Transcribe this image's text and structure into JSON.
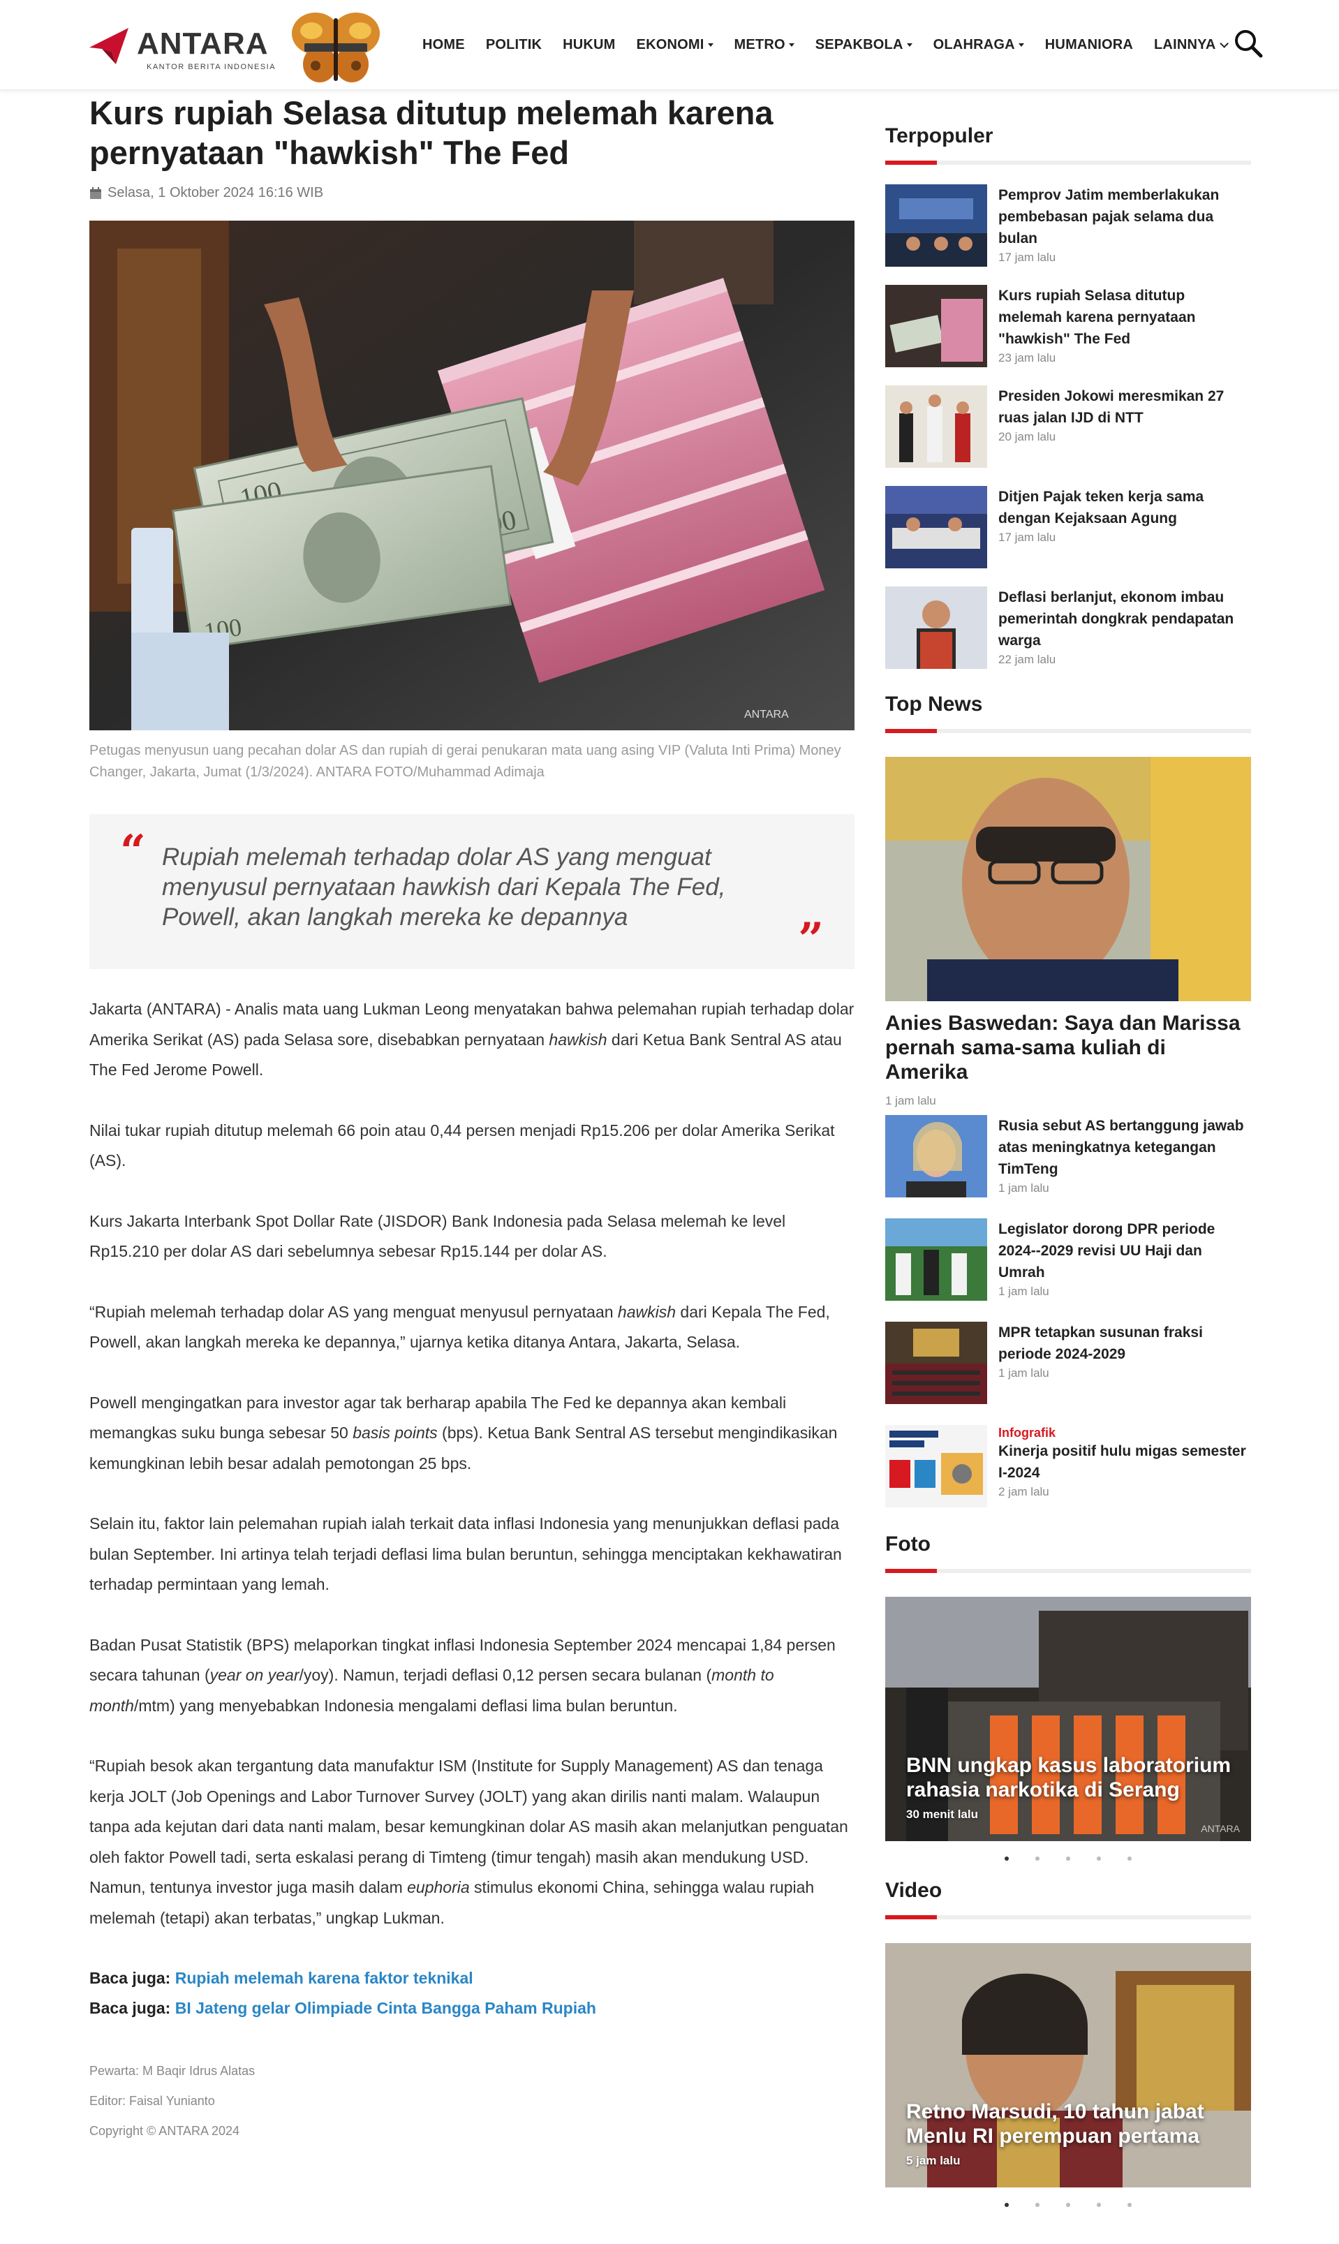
{
  "colors": {
    "accent": "#d71920",
    "link": "#2a86c5",
    "muted": "#888888"
  },
  "header": {
    "logo_text": "ANTARA",
    "logo_sub": "KANTOR BERITA INDONESIA",
    "nav": [
      {
        "label": "HOME",
        "dropdown": false
      },
      {
        "label": "POLITIK",
        "dropdown": false
      },
      {
        "label": "HUKUM",
        "dropdown": false
      },
      {
        "label": "EKONOMI",
        "dropdown": true
      },
      {
        "label": "METRO",
        "dropdown": true
      },
      {
        "label": "SEPAKBOLA",
        "dropdown": true
      },
      {
        "label": "OLAHRAGA",
        "dropdown": true
      },
      {
        "label": "HUMANIORA",
        "dropdown": false
      },
      {
        "label": "LAINNYA",
        "dropdown": true
      }
    ],
    "search_icon": "search-icon"
  },
  "article": {
    "title": "Kurs rupiah Selasa ditutup melemah karena pernyataan \"hawkish\" The Fed",
    "date": "Selasa, 1 Oktober 2024 16:16 WIB",
    "image_watermark": "ANTARA",
    "caption": "Petugas menyusun uang pecahan dolar AS dan rupiah di gerai penukaran mata uang asing VIP (Valuta Inti Prima) Money Changer, Jakarta, Jumat (1/3/2024). ANTARA FOTO/Muhammad Adimaja",
    "quote": "Rupiah melemah terhadap dolar AS yang menguat menyusul pernyataan hawkish dari Kepala The Fed, Powell, akan langkah mereka ke depannya",
    "paragraphs": [
      "Jakarta (ANTARA) - Analis mata uang Lukman Leong menyatakan bahwa pelemahan rupiah terhadap dolar Amerika Serikat (AS) pada Selasa sore, disebabkan pernyataan <em>hawkish</em> dari Ketua Bank Sentral AS atau The Fed Jerome Powell.",
      "Nilai tukar rupiah ditutup melemah 66 poin atau 0,44 persen menjadi Rp15.206 per dolar Amerika Serikat (AS).",
      "Kurs Jakarta Interbank Spot Dollar Rate (JISDOR) Bank Indonesia pada Selasa melemah ke level Rp15.210 per dolar AS dari sebelumnya sebesar Rp15.144 per dolar AS.",
      "“Rupiah melemah terhadap dolar AS yang menguat menyusul pernyataan <em>hawkish</em> dari Kepala The Fed, Powell, akan langkah mereka ke depannya,” ujarnya ketika ditanya Antara, Jakarta, Selasa.",
      "Powell mengingatkan para investor agar tak berharap apabila The Fed ke depannya akan kembali memangkas suku bunga sebesar 50 <em>basis points</em> (bps). Ketua Bank Sentral AS tersebut mengindikasikan kemungkinan lebih besar adalah pemotongan 25 bps.",
      "Selain itu, faktor lain pelemahan rupiah ialah terkait data inflasi Indonesia yang menunjukkan deflasi pada bulan September. Ini artinya telah terjadi deflasi lima bulan beruntun, sehingga menciptakan kekhawatiran terhadap permintaan yang lemah.",
      "Badan Pusat Statistik (BPS) melaporkan tingkat inflasi Indonesia September 2024 mencapai 1,84 persen secara tahunan (<em>year on year</em>/yoy). Namun, terjadi deflasi 0,12 persen secara bulanan (<em>month to month</em>/mtm) yang menyebabkan Indonesia mengalami deflasi lima bulan beruntun.",
      "“Rupiah besok akan tergantung data manufaktur ISM (Institute for Supply Management) AS dan tenaga kerja JOLT (Job Openings and Labor Turnover Survey (JOLT) yang akan dirilis nanti malam. Walaupun tanpa ada kejutan dari data nanti malam, besar kemungkinan dolar AS masih akan melanjutkan penguatan oleh faktor Powell tadi, serta eskalasi perang di Timteng (timur tengah) masih akan mendukung USD. Namun, tentunya investor juga masih dalam <em>euphoria</em> stimulus ekonomi China, sehingga walau rupiah melemah (tetapi) akan terbatas,” ungkap Lukman."
    ],
    "related_label": "Baca juga:",
    "related": [
      "Rupiah melemah karena faktor teknikal",
      "BI Jateng gelar Olimpiade Cinta Bangga Paham Rupiah"
    ],
    "credits": [
      "Pewarta: M Baqir Idrus Alatas",
      "Editor: Faisal Yunianto",
      "Copyright © ANTARA 2024"
    ]
  },
  "sidebar": {
    "terpopuler": {
      "title": "Terpopuler",
      "items": [
        {
          "title": "Pemprov Jatim memberlakukan pembebasan pajak selama dua bulan",
          "time": "17 jam lalu"
        },
        {
          "title": "Kurs rupiah Selasa ditutup melemah karena pernyataan \"hawkish\" The Fed",
          "time": "23 jam lalu"
        },
        {
          "title": "Presiden Jokowi meresmikan 27 ruas jalan IJD di NTT",
          "time": "20 jam lalu"
        },
        {
          "title": "Ditjen Pajak teken kerja sama dengan Kejaksaan Agung",
          "time": "17 jam lalu"
        },
        {
          "title": "Deflasi berlanjut, ekonom imbau pemerintah dongkrak pendapatan warga",
          "time": "22 jam lalu"
        }
      ]
    },
    "top_news": {
      "title": "Top News",
      "headline": "Anies Baswedan: Saya dan Marissa pernah sama-sama kuliah di Amerika",
      "headline_time": "1 jam lalu",
      "items": [
        {
          "category": "",
          "title": "Rusia sebut AS bertanggung jawab atas meningkatnya ketegangan TimTeng",
          "time": "1 jam lalu"
        },
        {
          "category": "",
          "title": "Legislator dorong DPR periode 2024--2029 revisi UU Haji dan Umrah",
          "time": "1 jam lalu"
        },
        {
          "category": "",
          "title": "MPR tetapkan susunan fraksi periode 2024-2029",
          "time": "1 jam lalu"
        },
        {
          "category": "Infografik",
          "title": "Kinerja positif hulu migas semester I-2024",
          "time": "2 jam lalu"
        }
      ]
    },
    "foto": {
      "title": "Foto",
      "card_title": "BNN ungkap kasus laboratorium rahasia narkotika di Serang",
      "card_time": "30 menit lalu",
      "card_watermark": "ANTARA",
      "dots": 5,
      "active_dot": 0
    },
    "video": {
      "title": "Video",
      "card_title": "Retno Marsudi, 10 tahun jabat Menlu RI perempuan pertama",
      "card_time": "5 jam lalu",
      "dots": 5,
      "active_dot": 0
    }
  }
}
